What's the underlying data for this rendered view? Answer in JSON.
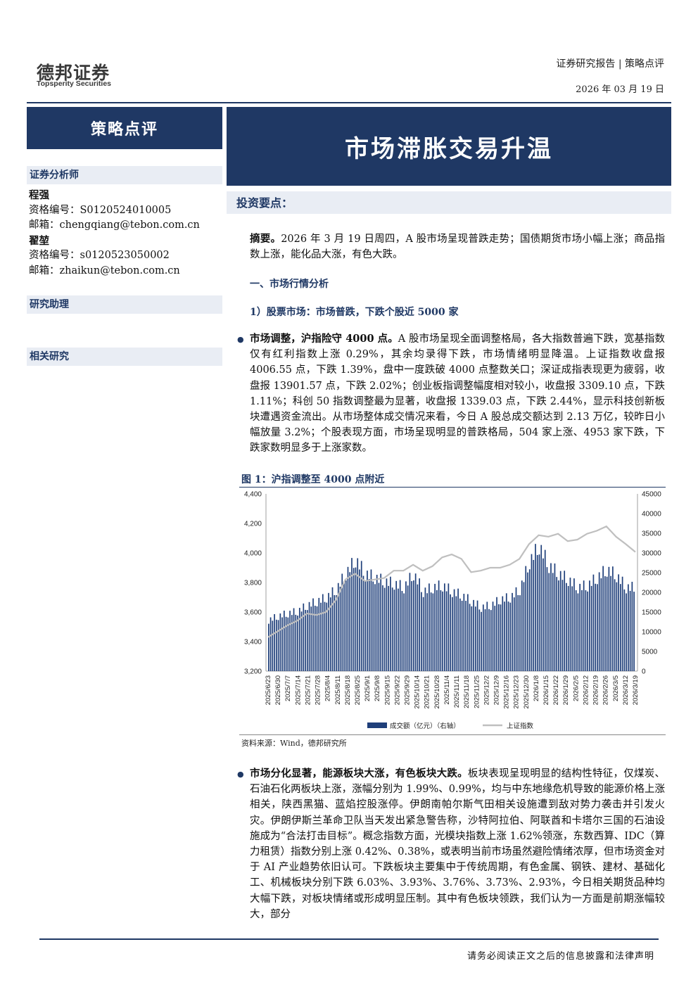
{
  "header": {
    "logo_cn": "德邦证券",
    "logo_en": "Topsperity Securities",
    "report_type": "证券研究报告 | 策略点评",
    "date": "2026 年 03 月 19 日"
  },
  "sidebar": {
    "category": "策略点评",
    "analyst_heading": "证券分析师",
    "analysts": [
      {
        "name": "程强",
        "cert": "资格编号：S0120524010005",
        "email": "邮箱：chengqiang@tebon.com.cn"
      },
      {
        "name": "翟堃",
        "cert": "资格编号：s0120523050002",
        "email": "邮箱：zhaikun@tebon.com.cn"
      }
    ],
    "assistant_heading": "研究助理",
    "related_heading": "相关研究"
  },
  "title": "市场滞胀交易升温",
  "invest_heading": "投资要点：",
  "summary": {
    "label": "摘要。",
    "text": "2026 年 3 月 19 日周四，A 股市场呈现普跌走势；国债期货市场小幅上涨；商品指数上涨，能化品大涨，有色大跌。"
  },
  "section1": "一、市场行情分析",
  "section1_1": "1）股票市场：市场普跌，下跌个股近 5000 家",
  "para1": {
    "bold": "市场调整，沪指险守 4000 点。",
    "text": "A 股市场呈现全面调整格局，各大指数普遍下跌，宽基指数仅有红利指数上涨 0.29%，其余均录得下跌，市场情绪明显降温。上证指数收盘报 4006.55 点，下跌 1.39%，盘中一度跌破 4000 点整数关口；深证成指表现更为疲弱，收盘报 13901.57 点，下跌 2.02%；创业板指调整幅度相对较小，收盘报 3309.10 点，下跌 1.11%；科创 50 指数调整最为显著，收盘报 1339.03 点，下跌 2.44%，显示科技创新板块遭遇资金流出。从市场整体成交情况来看，今日 A 股总成交额达到 2.13 万亿，较昨日小幅放量 3.2%；个股表现方面，市场呈现明显的普跌格局，504 家上涨、4953 家下跌，下跌家数明显多于上涨家数。"
  },
  "figure": {
    "title": "图 1：沪指调整至 4000 点附近",
    "source": "资料来源：Wind，德邦研究所"
  },
  "chart_data": {
    "type": "bar",
    "title": "图 1：沪指调整至 4000 点附近",
    "x_tick_labels": [
      "2025/6/23",
      "2025/6/30",
      "2025/7/7",
      "2025/7/14",
      "2025/7/21",
      "2025/7/28",
      "2025/8/4",
      "2025/8/11",
      "2025/8/18",
      "2025/8/25",
      "2025/9/1",
      "2025/9/8",
      "2025/9/15",
      "2025/9/22",
      "2025/9/29",
      "2025/10/6",
      "2025/10/13",
      "2025/10/20",
      "2025/10/27",
      "2025/11/3",
      "2025/11/10",
      "2025/11/17",
      "2025/11/24",
      "2025/12/1",
      "2025/12/8",
      "2025/12/15",
      "2025/12/22",
      "2025/12/29",
      "2026/1/5",
      "2026/1/12",
      "2026/1/19",
      "2026/1/26",
      "2026/2/2",
      "2026/2/9",
      "2026/2/16",
      "2026/2/23",
      "2026/3/2",
      "2026/3/9",
      "2026/3/16"
    ],
    "x_tick_labels_shown": [
      "2025/6/23",
      "2025/6/30",
      "2025/7/7",
      "2025/7/14",
      "2025/7/21",
      "2025/7/28",
      "2025/8/4",
      "2025/8/11",
      "2025/8/18",
      "2025/8/25",
      "2025/9/1",
      "2025/9/8",
      "2025/9/15",
      "2025/9/22",
      "2025/9/29",
      "2025/10/14",
      "2025/10/21",
      "2025/10/28",
      "2025/11/4",
      "2025/11/11",
      "2025/11/18",
      "2025/11/25",
      "2025/12/2",
      "2025/12/9",
      "2025/12/16",
      "2025/12/23",
      "2025/12/30",
      "2026/1/8",
      "2026/1/15",
      "2026/1/22",
      "2026/1/29",
      "2026/2/5",
      "2026/2/12",
      "2026/2/19",
      "2026/2/26",
      "2026/3/5",
      "2026/3/12",
      "2026/3/19"
    ],
    "series": [
      {
        "name": "成交额（亿元）（右轴）",
        "axis": "right",
        "kind": "bar",
        "weekly_avg": [
          12800,
          13800,
          14500,
          15000,
          16500,
          17500,
          18500,
          20500,
          24500,
          28000,
          24500,
          23500,
          22500,
          22000,
          21000,
          24500,
          20000,
          21000,
          21500,
          20000,
          19000,
          17500,
          16000,
          16500,
          18000,
          18500,
          20500,
          27500,
          31500,
          26500,
          24500,
          23000,
          21000,
          21500,
          23500,
          25500,
          24000,
          21000
        ]
      },
      {
        "name": "上证指数",
        "axis": "left",
        "kind": "line",
        "weekly_close": [
          3430,
          3470,
          3510,
          3540,
          3590,
          3580,
          3600,
          3680,
          3820,
          3860,
          3810,
          3820,
          3830,
          3880,
          3880,
          3920,
          3880,
          3910,
          3970,
          3990,
          3960,
          3870,
          3880,
          3900,
          3900,
          3920,
          3960,
          4060,
          4120,
          4110,
          4130,
          4080,
          4090,
          4130,
          4150,
          4180,
          4110,
          4060,
          4006.55
        ]
      }
    ],
    "y_left_range": [
      3200,
      4400
    ],
    "y_left_ticks": [
      "3,200",
      "3,400",
      "3,600",
      "3,800",
      "4,000",
      "4,200",
      "4,400"
    ],
    "y_right_range": [
      0,
      45000
    ],
    "y_right_ticks": [
      "0",
      "5000",
      "10000",
      "15000",
      "20000",
      "25000",
      "30000",
      "35000",
      "40000",
      "45000"
    ],
    "legend": [
      "成交额（亿元）（右轴）",
      "上证指数"
    ],
    "legend_position": "bottom"
  },
  "para2": {
    "bold": "市场分化显著，能源板块大涨，有色板块大跌。",
    "text": "板块表现呈现明显的结构性特征，仅煤炭、石油石化两板块上涨，涨幅分别为 1.99%、0.99%，均与中东地缘危机导致的能源价格上涨相关，陕西黑猫、蓝焰控股涨停。伊朗南帕尔斯气田相关设施遭到敌对势力袭击并引发火灾。伊朗伊斯兰革命卫队当天发出紧急警告称，沙特阿拉伯、阿联酋和卡塔尔三国的石油设施成为“合法打击目标”。概念指数方面，光模块指数上涨 1.62%领涨，东数西算、IDC（算力租赁）指数分别上涨 0.42%、0.38%，或表明当前市场虽然避险情绪浓厚，但市场资金对于 AI 产业趋势依旧认可。下跌板块主要集中于传统周期，有色金属、钢铁、建材、基础化工、机械板块分别下跌 6.03%、3.93%、3.76%、3.73%、2.93%，今日相关期货品种均大幅下跌，对板块情绪或形成明显压制。其中有色板块领跌，我们认为一方面是前期涨幅较大，部分"
  },
  "footer": "请务必阅读正文之后的信息披露和法律声明",
  "colors": {
    "navy": "#1f3864",
    "bar": "#1f3f7a",
    "line": "#bfbfbf",
    "light_panel": "#e9edf4"
  }
}
